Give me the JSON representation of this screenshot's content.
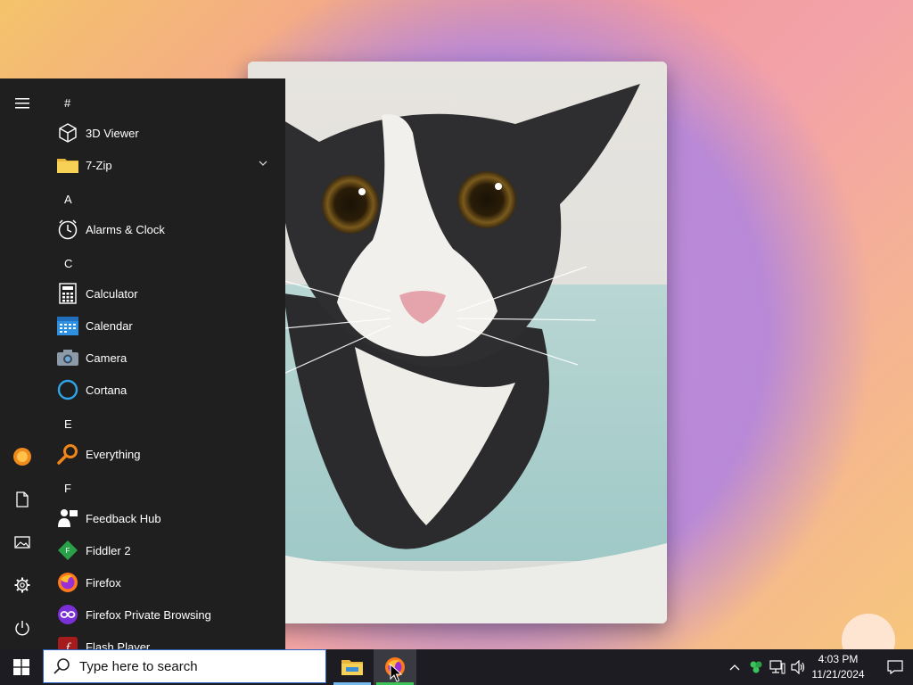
{
  "start_menu": {
    "rail": {
      "items": [
        {
          "name": "expand",
          "icon": "hamburger-icon"
        },
        {
          "name": "user",
          "icon": "user-avatar-icon"
        },
        {
          "name": "documents",
          "icon": "document-icon"
        },
        {
          "name": "pictures",
          "icon": "pictures-icon"
        },
        {
          "name": "settings",
          "icon": "gear-icon"
        },
        {
          "name": "power",
          "icon": "power-icon"
        }
      ]
    },
    "sections": {
      "hash": "#",
      "a": "A",
      "c": "C",
      "e": "E",
      "f": "F"
    },
    "apps": [
      {
        "label": "3D Viewer",
        "icon": "cube-icon"
      },
      {
        "label": "7-Zip",
        "icon": "folder-icon",
        "expandable": true
      },
      {
        "label": "Alarms & Clock",
        "icon": "clock-icon"
      },
      {
        "label": "Calculator",
        "icon": "calculator-icon"
      },
      {
        "label": "Calendar",
        "icon": "calendar-icon"
      },
      {
        "label": "Camera",
        "icon": "camera-icon"
      },
      {
        "label": "Cortana",
        "icon": "cortana-icon"
      },
      {
        "label": "Everything",
        "icon": "magnifier-icon"
      },
      {
        "label": "Feedback Hub",
        "icon": "feedback-icon"
      },
      {
        "label": "Fiddler 2",
        "icon": "fiddler-icon"
      },
      {
        "label": "Firefox",
        "icon": "firefox-icon"
      },
      {
        "label": "Firefox Private Browsing",
        "icon": "firefox-private-icon"
      },
      {
        "label": "Flash Player",
        "icon": "flash-icon"
      }
    ]
  },
  "taskbar": {
    "search_placeholder": "Type here to search",
    "pinned": [
      {
        "name": "File Explorer",
        "icon": "file-explorer-icon"
      },
      {
        "name": "Firefox",
        "icon": "firefox-icon"
      }
    ],
    "clock": {
      "time": "4:03 PM",
      "date": "11/21/2024"
    },
    "tray_icons": [
      "chevron-up-icon",
      "recycle-icon",
      "network-icon",
      "volume-icon"
    ]
  },
  "colors": {
    "start_bg": "#1f1f1f",
    "taskbar_bg": "#1c1c22",
    "accent_blue": "#2b63c7",
    "active_underline": "#76b9ed"
  }
}
